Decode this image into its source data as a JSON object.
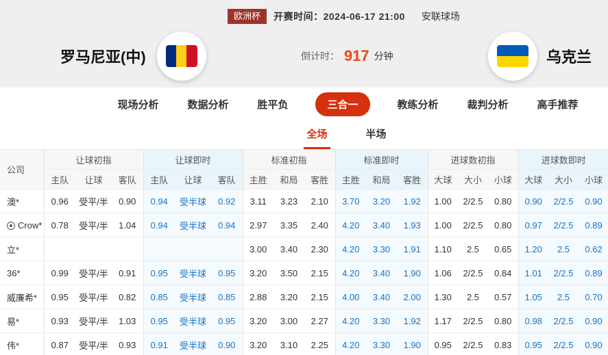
{
  "header": {
    "league_badge": "欧洲杯",
    "kickoff_label": "开赛时间：",
    "kickoff_time": "2024-06-17 21:00",
    "venue": "安联球场",
    "home_team": "罗马尼亚(中)",
    "away_team": "乌克兰",
    "countdown_label": "倒计时：",
    "countdown_value": "917",
    "countdown_unit": "分钟"
  },
  "nav": {
    "items": [
      {
        "label": "现场分析",
        "active": false
      },
      {
        "label": "数据分析",
        "active": false
      },
      {
        "label": "胜平负",
        "active": false
      },
      {
        "label": "三合一",
        "active": true
      },
      {
        "label": "教练分析",
        "active": false
      },
      {
        "label": "裁判分析",
        "active": false
      },
      {
        "label": "高手推荐",
        "active": false
      }
    ]
  },
  "subtabs": [
    {
      "label": "全场",
      "active": true
    },
    {
      "label": "半场",
      "active": false
    }
  ],
  "table": {
    "company_header": "公司",
    "groups": [
      {
        "label": "让球初指",
        "type": "initial",
        "cols": [
          "主队",
          "让球",
          "客队"
        ]
      },
      {
        "label": "让球即时",
        "type": "live",
        "cols": [
          "主队",
          "让球",
          "客队"
        ]
      },
      {
        "label": "标准初指",
        "type": "initial",
        "cols": [
          "主胜",
          "和局",
          "客胜"
        ]
      },
      {
        "label": "标准即时",
        "type": "live",
        "cols": [
          "主胜",
          "和局",
          "客胜"
        ]
      },
      {
        "label": "进球数初指",
        "type": "initial",
        "cols": [
          "大球",
          "大小",
          "小球"
        ]
      },
      {
        "label": "进球数即时",
        "type": "live",
        "cols": [
          "大球",
          "大小",
          "小球"
        ]
      }
    ],
    "rows": [
      {
        "company": "澳*",
        "has_icon": false,
        "cells": [
          "0.96",
          "受平/半",
          "0.90",
          "0.94",
          "受半球",
          "0.92",
          "3.11",
          "3.23",
          "2.10",
          "3.70",
          "3.20",
          "1.92",
          "1.00",
          "2/2.5",
          "0.80",
          "0.90",
          "2/2.5",
          "0.90"
        ]
      },
      {
        "company": "Crow*",
        "has_icon": true,
        "cells": [
          "0.78",
          "受平/半",
          "1.04",
          "0.94",
          "受半球",
          "0.94",
          "2.97",
          "3.35",
          "2.40",
          "4.20",
          "3.40",
          "1.93",
          "1.00",
          "2/2.5",
          "0.80",
          "0.97",
          "2/2.5",
          "0.89"
        ]
      },
      {
        "company": "立*",
        "has_icon": false,
        "cells": [
          "",
          "",
          "",
          "",
          "",
          "",
          "3.00",
          "3.40",
          "2.30",
          "4.20",
          "3.30",
          "1.91",
          "1.10",
          "2.5",
          "0.65",
          "1.20",
          "2.5",
          "0.62"
        ]
      },
      {
        "company": "36*",
        "has_icon": false,
        "cells": [
          "0.99",
          "受平/半",
          "0.91",
          "0.95",
          "受半球",
          "0.95",
          "3.20",
          "3.50",
          "2.15",
          "4.20",
          "3.40",
          "1.90",
          "1.06",
          "2/2.5",
          "0.84",
          "1.01",
          "2/2.5",
          "0.89"
        ]
      },
      {
        "company": "威廉希*",
        "has_icon": false,
        "cells": [
          "0.95",
          "受平/半",
          "0.82",
          "0.85",
          "受半球",
          "0.85",
          "2.88",
          "3.20",
          "2.15",
          "4.00",
          "3.40",
          "2.00",
          "1.30",
          "2.5",
          "0.57",
          "1.05",
          "2.5",
          "0.70"
        ]
      },
      {
        "company": "易*",
        "has_icon": false,
        "cells": [
          "0.93",
          "受平/半",
          "1.03",
          "0.95",
          "受半球",
          "0.95",
          "3.20",
          "3.00",
          "2.27",
          "4.20",
          "3.30",
          "1.92",
          "1.17",
          "2/2.5",
          "0.80",
          "0.98",
          "2/2.5",
          "0.90"
        ]
      },
      {
        "company": "伟*",
        "has_icon": false,
        "cells": [
          "0.87",
          "受平/半",
          "0.93",
          "0.91",
          "受半球",
          "0.90",
          "3.20",
          "3.10",
          "2.25",
          "4.20",
          "3.30",
          "1.90",
          "0.95",
          "2/2.5",
          "0.83",
          "0.95",
          "2/2.5",
          "0.90"
        ]
      }
    ]
  },
  "colors": {
    "accent_red": "#d5310e",
    "badge_maroon": "#9c342c",
    "countdown_orange": "#f0490f",
    "live_blue": "#1673c8",
    "romania_flag": [
      "#002b7f",
      "#fcd116",
      "#ce1126"
    ],
    "ukraine_flag": [
      "#005bbb",
      "#ffd500"
    ]
  }
}
